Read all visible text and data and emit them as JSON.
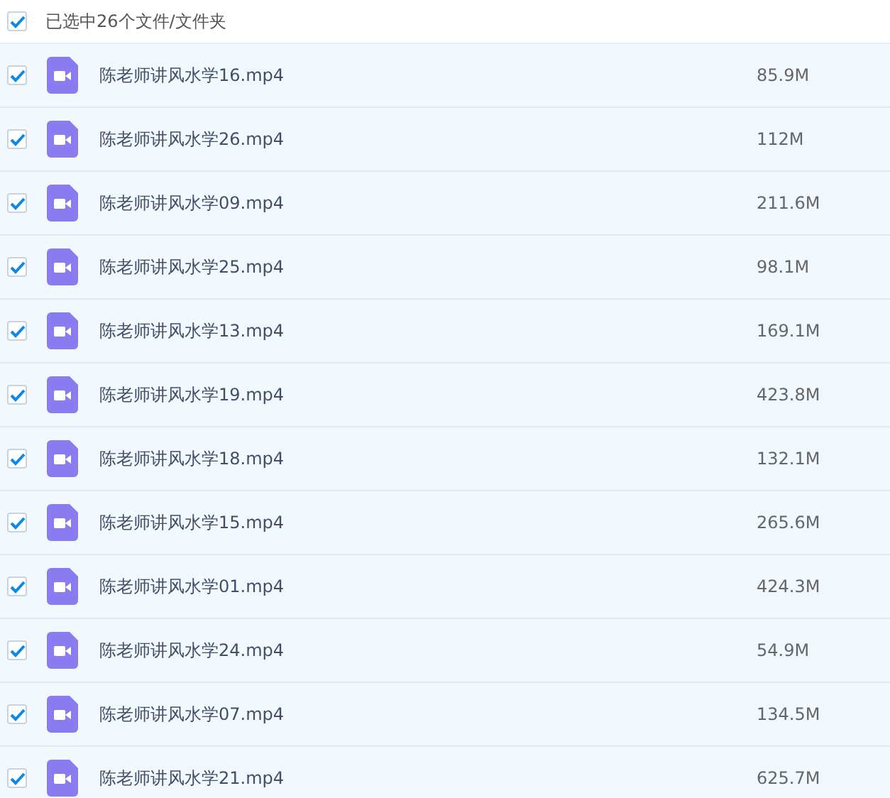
{
  "header": {
    "label": "已选中26个文件/文件夹",
    "checked": true
  },
  "files": [
    {
      "name": "陈老师讲风水学16.mp4",
      "size": "85.9M",
      "checked": true
    },
    {
      "name": "陈老师讲风水学26.mp4",
      "size": "112M",
      "checked": true
    },
    {
      "name": "陈老师讲风水学09.mp4",
      "size": "211.6M",
      "checked": true
    },
    {
      "name": "陈老师讲风水学25.mp4",
      "size": "98.1M",
      "checked": true
    },
    {
      "name": "陈老师讲风水学13.mp4",
      "size": "169.1M",
      "checked": true
    },
    {
      "name": "陈老师讲风水学19.mp4",
      "size": "423.8M",
      "checked": true
    },
    {
      "name": "陈老师讲风水学18.mp4",
      "size": "132.1M",
      "checked": true
    },
    {
      "name": "陈老师讲风水学15.mp4",
      "size": "265.6M",
      "checked": true
    },
    {
      "name": "陈老师讲风水学01.mp4",
      "size": "424.3M",
      "checked": true
    },
    {
      "name": "陈老师讲风水学24.mp4",
      "size": "54.9M",
      "checked": true
    },
    {
      "name": "陈老师讲风水学07.mp4",
      "size": "134.5M",
      "checked": true
    },
    {
      "name": "陈老师讲风水学21.mp4",
      "size": "625.7M",
      "checked": true
    }
  ]
}
